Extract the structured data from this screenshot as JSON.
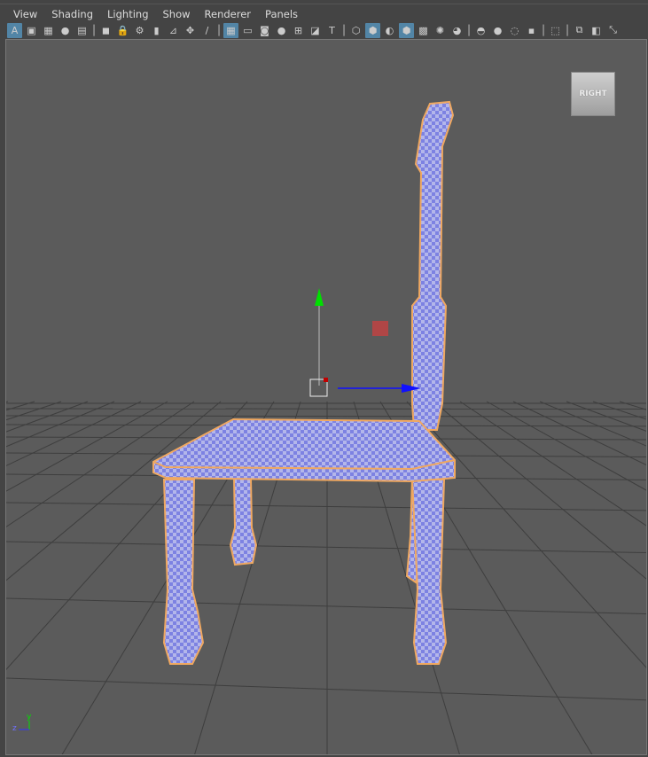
{
  "menu": [
    "View",
    "Shading",
    "Lighting",
    "Show",
    "Renderer",
    "Panels"
  ],
  "toolbar": [
    {
      "icon": "select-camera-icon",
      "glyph": "A",
      "on": true
    },
    {
      "icon": "camera-attributes-icon",
      "glyph": "▣"
    },
    {
      "icon": "bookmark-frame-icon",
      "glyph": "▦"
    },
    {
      "icon": "image-plane-icon",
      "glyph": "●"
    },
    {
      "icon": "2d-pan-zoom-icon",
      "glyph": "▤"
    },
    {
      "sep": true
    },
    {
      "icon": "camera-icon",
      "glyph": "◼"
    },
    {
      "icon": "lock-camera-icon",
      "glyph": "🔒"
    },
    {
      "icon": "camera-settings-icon",
      "glyph": "⚙"
    },
    {
      "icon": "bookmark-icon",
      "glyph": "▮"
    },
    {
      "icon": "grease-pencil-icon",
      "glyph": "⊿"
    },
    {
      "icon": "2d-pan-icon",
      "glyph": "✥"
    },
    {
      "icon": "brush-icon",
      "glyph": "/"
    },
    {
      "sep": true
    },
    {
      "icon": "grid-icon",
      "glyph": "▦",
      "on": true
    },
    {
      "icon": "film-gate-icon",
      "glyph": "▭"
    },
    {
      "icon": "resolution-gate-icon",
      "glyph": "◙"
    },
    {
      "icon": "gate-mask-icon",
      "glyph": "●"
    },
    {
      "icon": "field-chart-icon",
      "glyph": "⊞"
    },
    {
      "icon": "safe-action-icon",
      "glyph": "◪"
    },
    {
      "icon": "safe-title-icon",
      "glyph": "T"
    },
    {
      "sep": true
    },
    {
      "icon": "wireframe-icon",
      "glyph": "⬡"
    },
    {
      "icon": "smooth-shade-icon",
      "glyph": "⬢",
      "on": true
    },
    {
      "icon": "default-material-icon",
      "glyph": "◐"
    },
    {
      "icon": "wireframe-on-shaded-icon",
      "glyph": "⬢",
      "on": true
    },
    {
      "icon": "textured-icon",
      "glyph": "▩"
    },
    {
      "icon": "lights-icon",
      "glyph": "✺"
    },
    {
      "icon": "shadows-icon",
      "glyph": "◕"
    },
    {
      "sep": true
    },
    {
      "icon": "ambient-occlusion-icon",
      "glyph": "◓"
    },
    {
      "icon": "motion-blur-icon",
      "glyph": "●"
    },
    {
      "icon": "anti-alias-icon",
      "glyph": "◌"
    },
    {
      "icon": "depth-of-field-icon",
      "glyph": "▪"
    },
    {
      "sep": true
    },
    {
      "icon": "isolate-select-icon",
      "glyph": "⬚"
    },
    {
      "sep": true
    },
    {
      "icon": "xray-icon",
      "glyph": "⧉"
    },
    {
      "icon": "xray-joints-icon",
      "glyph": "◧"
    },
    {
      "icon": "xray-components-icon",
      "glyph": "⤡"
    }
  ],
  "viewcube": {
    "label": "RIGHT"
  },
  "axis": {
    "y": "y",
    "z": "z"
  },
  "colors": {
    "viewport": "#5b5b5b",
    "mesh_blue": "#7c80e0",
    "outline": "#f0a860",
    "manip_green": "#00e000",
    "manip_blue": "#1010ff"
  }
}
